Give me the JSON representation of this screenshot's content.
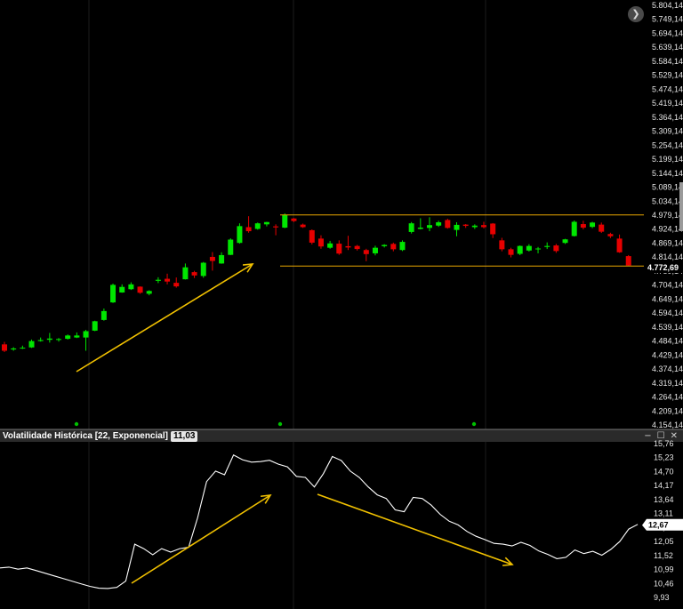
{
  "chart_data": [
    {
      "type": "candlestick",
      "title": "",
      "ylim": [
        4154.14,
        5804.14
      ],
      "y_ticks": [
        "5.804,14",
        "5.749,14",
        "5.694,14",
        "5.639,14",
        "5.584,14",
        "5.529,14",
        "5.474,14",
        "5.419,14",
        "5.364,14",
        "5.309,14",
        "5.254,14",
        "5.199,14",
        "5.144,14",
        "5.089,14",
        "5.034,14",
        "4.979,14",
        "4.924,14",
        "4.869,14",
        "4.814,14",
        "4.759,14",
        "4.704,14",
        "4.649,14",
        "4.594,14",
        "4.539,14",
        "4.484,14",
        "4.429,14",
        "4.374,14",
        "4.319,14",
        "4.264,14",
        "4.209,14",
        "4.154,14"
      ],
      "last_price_label": "4.772,69",
      "up_color": "#00e600",
      "down_color": "#e60000",
      "candles": [
        {
          "o": 4471,
          "h": 4481,
          "l": 4441,
          "c": 4446
        },
        {
          "o": 4451,
          "h": 4460,
          "l": 4446,
          "c": 4455
        },
        {
          "o": 4455,
          "h": 4466,
          "l": 4453,
          "c": 4458
        },
        {
          "o": 4459,
          "h": 4490,
          "l": 4457,
          "c": 4484
        },
        {
          "o": 4484,
          "h": 4498,
          "l": 4482,
          "c": 4488
        },
        {
          "o": 4489,
          "h": 4516,
          "l": 4478,
          "c": 4494
        },
        {
          "o": 4490,
          "h": 4496,
          "l": 4482,
          "c": 4492
        },
        {
          "o": 4493,
          "h": 4510,
          "l": 4490,
          "c": 4506
        },
        {
          "o": 4498,
          "h": 4518,
          "l": 4496,
          "c": 4506
        },
        {
          "o": 4498,
          "h": 4528,
          "l": 4446,
          "c": 4523
        },
        {
          "o": 4525,
          "h": 4564,
          "l": 4523,
          "c": 4562
        },
        {
          "o": 4567,
          "h": 4612,
          "l": 4564,
          "c": 4602
        },
        {
          "o": 4636,
          "h": 4710,
          "l": 4634,
          "c": 4705
        },
        {
          "o": 4675,
          "h": 4707,
          "l": 4674,
          "c": 4697
        },
        {
          "o": 4688,
          "h": 4715,
          "l": 4685,
          "c": 4707
        },
        {
          "o": 4698,
          "h": 4699,
          "l": 4670,
          "c": 4674
        },
        {
          "o": 4670,
          "h": 4684,
          "l": 4664,
          "c": 4681
        },
        {
          "o": 4721,
          "h": 4735,
          "l": 4712,
          "c": 4725
        },
        {
          "o": 4729,
          "h": 4749,
          "l": 4707,
          "c": 4718
        },
        {
          "o": 4713,
          "h": 4734,
          "l": 4694,
          "c": 4699
        },
        {
          "o": 4727,
          "h": 4789,
          "l": 4726,
          "c": 4774
        },
        {
          "o": 4755,
          "h": 4760,
          "l": 4732,
          "c": 4742
        },
        {
          "o": 4740,
          "h": 4795,
          "l": 4733,
          "c": 4792
        },
        {
          "o": 4815,
          "h": 4834,
          "l": 4761,
          "c": 4799
        },
        {
          "o": 4789,
          "h": 4833,
          "l": 4788,
          "c": 4822
        },
        {
          "o": 4823,
          "h": 4888,
          "l": 4822,
          "c": 4883
        },
        {
          "o": 4870,
          "h": 4947,
          "l": 4867,
          "c": 4936
        },
        {
          "o": 4932,
          "h": 4975,
          "l": 4910,
          "c": 4916
        },
        {
          "o": 4925,
          "h": 4950,
          "l": 4922,
          "c": 4947
        },
        {
          "o": 4943,
          "h": 4953,
          "l": 4935,
          "c": 4952
        },
        {
          "o": 4935,
          "h": 4943,
          "l": 4900,
          "c": 4931
        },
        {
          "o": 4930,
          "h": 4986,
          "l": 4928,
          "c": 4981
        },
        {
          "o": 4966,
          "h": 4968,
          "l": 4952,
          "c": 4956
        },
        {
          "o": 4942,
          "h": 4946,
          "l": 4929,
          "c": 4932
        },
        {
          "o": 4920,
          "h": 4923,
          "l": 4864,
          "c": 4871
        },
        {
          "o": 4887,
          "h": 4900,
          "l": 4847,
          "c": 4856
        },
        {
          "o": 4851,
          "h": 4878,
          "l": 4847,
          "c": 4868
        },
        {
          "o": 4867,
          "h": 4880,
          "l": 4823,
          "c": 4828
        },
        {
          "o": 4857,
          "h": 4898,
          "l": 4842,
          "c": 4852
        },
        {
          "o": 4858,
          "h": 4862,
          "l": 4840,
          "c": 4846
        },
        {
          "o": 4842,
          "h": 4847,
          "l": 4798,
          "c": 4826
        },
        {
          "o": 4829,
          "h": 4859,
          "l": 4821,
          "c": 4851
        },
        {
          "o": 4857,
          "h": 4865,
          "l": 4852,
          "c": 4862
        },
        {
          "o": 4866,
          "h": 4871,
          "l": 4837,
          "c": 4845
        },
        {
          "o": 4842,
          "h": 4880,
          "l": 4838,
          "c": 4874
        },
        {
          "o": 4913,
          "h": 4952,
          "l": 4907,
          "c": 4947
        },
        {
          "o": 4925,
          "h": 4967,
          "l": 4923,
          "c": 4930
        },
        {
          "o": 4929,
          "h": 4971,
          "l": 4916,
          "c": 4940
        },
        {
          "o": 4938,
          "h": 4957,
          "l": 4933,
          "c": 4951
        },
        {
          "o": 4960,
          "h": 4965,
          "l": 4926,
          "c": 4929
        },
        {
          "o": 4921,
          "h": 4951,
          "l": 4896,
          "c": 4941
        },
        {
          "o": 4942,
          "h": 4944,
          "l": 4929,
          "c": 4937
        },
        {
          "o": 4932,
          "h": 4943,
          "l": 4925,
          "c": 4938
        },
        {
          "o": 4940,
          "h": 4953,
          "l": 4927,
          "c": 4932
        },
        {
          "o": 4946,
          "h": 4948,
          "l": 4889,
          "c": 4904
        },
        {
          "o": 4880,
          "h": 4890,
          "l": 4837,
          "c": 4845
        },
        {
          "o": 4845,
          "h": 4851,
          "l": 4813,
          "c": 4823
        },
        {
          "o": 4827,
          "h": 4860,
          "l": 4822,
          "c": 4858
        },
        {
          "o": 4840,
          "h": 4865,
          "l": 4836,
          "c": 4858
        },
        {
          "o": 4845,
          "h": 4854,
          "l": 4829,
          "c": 4848
        },
        {
          "o": 4854,
          "h": 4872,
          "l": 4846,
          "c": 4858
        },
        {
          "o": 4860,
          "h": 4866,
          "l": 4831,
          "c": 4838
        },
        {
          "o": 4870,
          "h": 4886,
          "l": 4866,
          "c": 4884
        },
        {
          "o": 4897,
          "h": 4958,
          "l": 4895,
          "c": 4953
        },
        {
          "o": 4944,
          "h": 4957,
          "l": 4923,
          "c": 4930
        },
        {
          "o": 4933,
          "h": 4953,
          "l": 4928,
          "c": 4950
        },
        {
          "o": 4942,
          "h": 4950,
          "l": 4909,
          "c": 4914
        },
        {
          "o": 4905,
          "h": 4910,
          "l": 4889,
          "c": 4896
        },
        {
          "o": 4887,
          "h": 4903,
          "l": 4831,
          "c": 4833
        },
        {
          "o": 4818,
          "h": 4822,
          "l": 4780,
          "c": 4781
        }
      ],
      "resistance_level": 4980,
      "support_level": 4779
    },
    {
      "type": "line",
      "title": "Volatilidade Histórica [22, Exponencial]",
      "current_value": "11,03",
      "y_ticks": [
        "15,76",
        "15,23",
        "14,70",
        "14,17",
        "13,64",
        "13,11",
        "12,58",
        "12,05",
        "11,52",
        "10,99",
        "10,46",
        "9,93"
      ],
      "ylim": [
        9.93,
        15.76
      ],
      "last_value_label": "12,67",
      "series": [
        {
          "values": [
            11.05,
            11.08,
            11.0,
            11.05,
            10.95,
            10.85,
            10.75,
            10.65,
            10.55,
            10.45,
            10.35,
            10.28,
            10.27,
            10.31,
            10.55,
            11.95,
            11.78,
            11.55,
            11.78,
            11.65,
            11.78,
            11.83,
            12.95,
            14.32,
            14.72,
            14.58,
            15.33,
            15.15,
            15.06,
            15.08,
            15.13,
            14.98,
            14.88,
            14.52,
            14.48,
            14.12,
            14.62,
            15.27,
            15.12,
            14.72,
            14.48,
            14.12,
            13.82,
            13.68,
            13.25,
            13.18,
            13.72,
            13.68,
            13.43,
            13.08,
            12.82,
            12.68,
            12.43,
            12.25,
            12.12,
            11.98,
            11.95,
            11.88,
            12.02,
            11.9,
            11.69,
            11.56,
            11.4,
            11.45,
            11.73,
            11.59,
            11.68,
            11.53,
            11.75,
            12.05,
            12.52,
            12.7
          ]
        }
      ]
    }
  ],
  "panel": {
    "title": "Volatilidade Histórica [22, Exponencial]",
    "value": "11,03",
    "minimize": "−",
    "maximize": "☐",
    "close": "✕"
  },
  "nav_button": "❯",
  "colors": {
    "background": "#000000",
    "level_line": "#e8a600",
    "arrow": "#f0c000",
    "vol_line": "#ffffff",
    "separator": "#777777",
    "marker_dot": "#00c000"
  }
}
